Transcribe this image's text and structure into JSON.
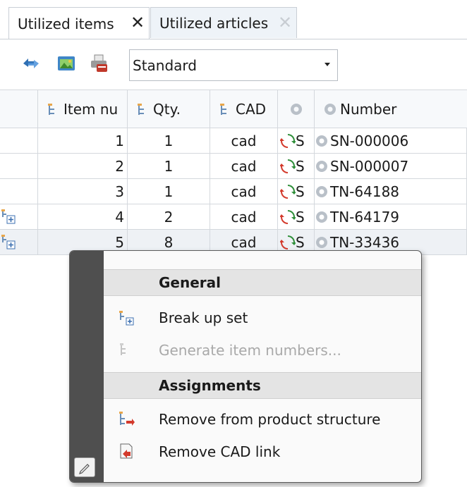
{
  "tabs": [
    {
      "label": "Utilized items",
      "close": "✕"
    },
    {
      "label": "Utilized articles",
      "close": "✕"
    }
  ],
  "toolbar": {
    "icons": [
      "refresh-icon",
      "image-view-icon",
      "print-pdf-icon"
    ],
    "view_select": "Standard"
  },
  "grid": {
    "columns": [
      "Item nu",
      "Qty.",
      "CAD",
      "",
      "Number"
    ],
    "rows": [
      {
        "item": "1",
        "qty": "1",
        "cad": "cad",
        "status": "S",
        "number": "SN-000006",
        "set_marker": false
      },
      {
        "item": "2",
        "qty": "1",
        "cad": "cad",
        "status": "S",
        "number": "SN-000007",
        "set_marker": false
      },
      {
        "item": "3",
        "qty": "1",
        "cad": "cad",
        "status": "S",
        "number": "TN-64188",
        "set_marker": false
      },
      {
        "item": "4",
        "qty": "2",
        "cad": "cad",
        "status": "S",
        "number": "TN-64179",
        "set_marker": true
      },
      {
        "item": "5",
        "qty": "8",
        "cad": "cad",
        "status": "S",
        "number": "TN-33436",
        "set_marker": true
      }
    ]
  },
  "context_menu": {
    "groups": [
      {
        "title": "General",
        "items": [
          {
            "label": "Break up set",
            "icon": "break-up-set-icon",
            "enabled": true
          },
          {
            "label": "Generate item numbers...",
            "icon": "generate-numbers-icon",
            "enabled": false
          }
        ]
      },
      {
        "title": "Assignments",
        "items": [
          {
            "label": "Remove from product structure",
            "icon": "remove-structure-icon",
            "enabled": true
          },
          {
            "label": "Remove CAD link",
            "icon": "remove-cad-link-icon",
            "enabled": true
          }
        ]
      }
    ]
  },
  "colors": {
    "menu_rail": "#4f4f4f",
    "group_header": "#e4e4e4",
    "disabled_text": "#a9a9a9"
  }
}
